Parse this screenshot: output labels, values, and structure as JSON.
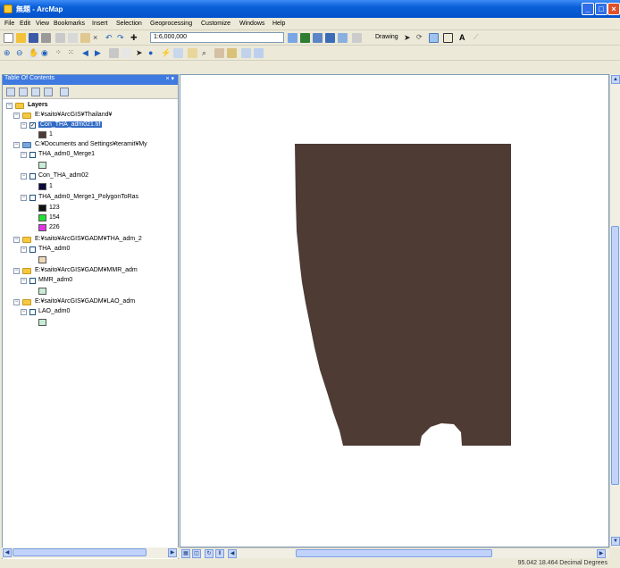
{
  "window": {
    "title": "無題 - ArcMap"
  },
  "menu": [
    "File",
    "Edit",
    "View",
    "Bookmarks",
    "Insert",
    "Selection",
    "Geoprocessing",
    "Customize",
    "Windows",
    "Help"
  ],
  "toolbar": {
    "scale": "1:6,000,000",
    "drawing_label": "Drawing"
  },
  "toc": {
    "header": "Table Of Contents",
    "root": "Layers",
    "groups": [
      {
        "path": "E:¥saito¥ArcGIS¥Thailand¥",
        "layers": [
          {
            "name": "Con_THA_adm021.tif",
            "checked": true,
            "selected": true,
            "legend": [
              {
                "color": "#4d3b34",
                "label": "1"
              }
            ]
          }
        ]
      },
      {
        "path": "C:¥Documents and Settings¥teramit¥My",
        "layers": [
          {
            "name": "THA_adm0_Merge1",
            "checked": false,
            "legend": [
              {
                "color": "#c8ecd6",
                "label": ""
              }
            ]
          },
          {
            "name": "Con_THA_adm02",
            "checked": false,
            "legend": [
              {
                "color": "#0a0a3c",
                "label": "1"
              }
            ]
          },
          {
            "name": "THA_adm0_Merge1_PolygonToRas",
            "checked": false,
            "legend": [
              {
                "color": "#111111",
                "label": "123"
              },
              {
                "color": "#22e033",
                "label": "154"
              },
              {
                "color": "#e033e6",
                "label": "226"
              }
            ]
          }
        ]
      },
      {
        "path": "E:¥saito¥ArcGIS¥GADM¥THA_adm_2",
        "layers": [
          {
            "name": "THA_adm0",
            "checked": false,
            "legend": [
              {
                "color": "#efd8b8",
                "label": ""
              }
            ]
          }
        ]
      },
      {
        "path": "E:¥saito¥ArcGIS¥GADM¥MMR_adm",
        "layers": [
          {
            "name": "MMR_adm0",
            "checked": false,
            "legend": [
              {
                "color": "#c8ecd6",
                "label": ""
              }
            ]
          }
        ]
      },
      {
        "path": "E:¥saito¥ArcGIS¥GADM¥LAO_adm",
        "layers": [
          {
            "name": "LAO_adm0",
            "checked": false,
            "legend": [
              {
                "color": "#c8ecd6",
                "label": ""
              }
            ]
          }
        ]
      }
    ]
  },
  "map": {
    "raster_color": "#4d3b34"
  },
  "status": {
    "coords": "95.042  18.464 Decimal Degrees"
  }
}
